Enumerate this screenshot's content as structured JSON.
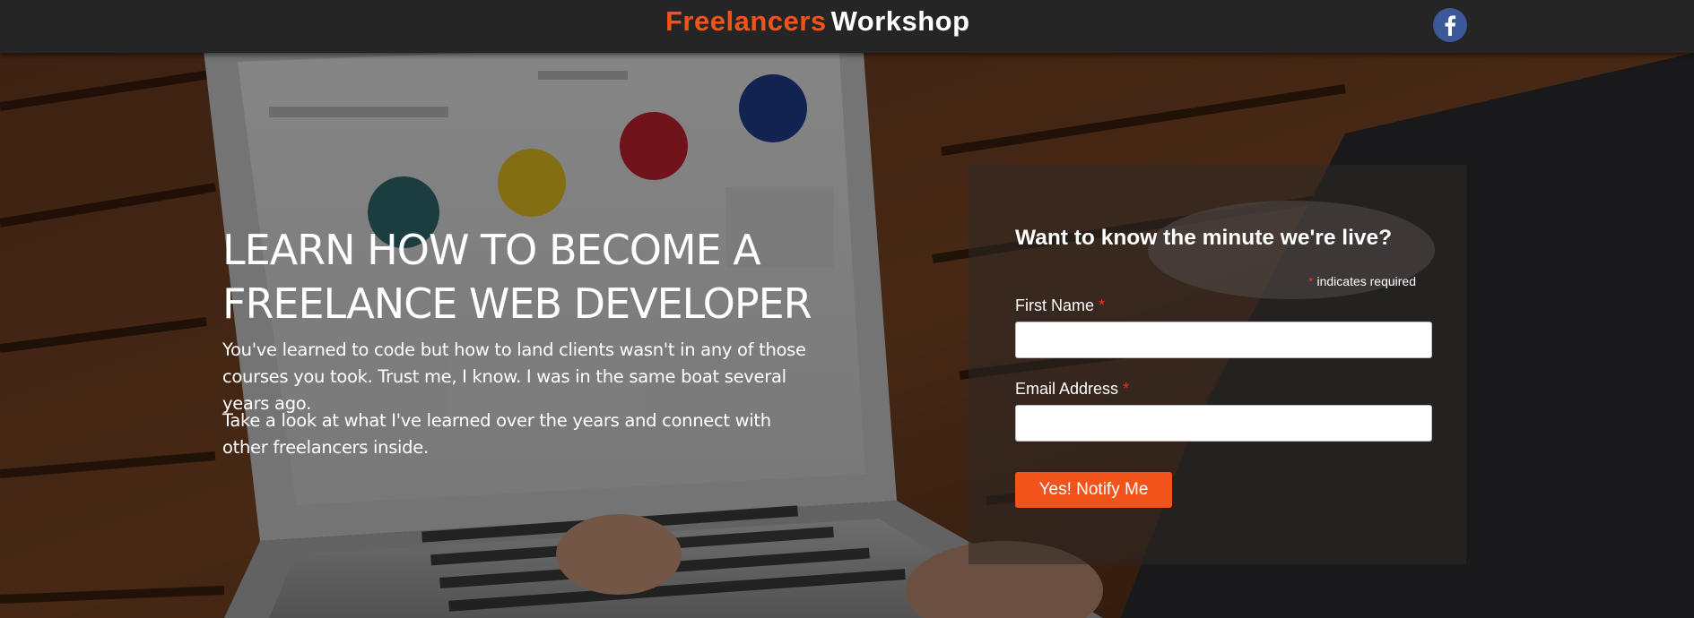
{
  "header": {
    "logo_word_1": "Freelancers",
    "logo_word_2": "Workshop",
    "social_icon": "facebook-icon"
  },
  "hero": {
    "headline": "LEARN HOW TO BECOME A FREELANCE WEB DEVELOPER",
    "paragraph_1": "You've learned to code but how to land clients wasn't in any of those courses you took. Trust me, I know. I was in the same boat several years ago.",
    "paragraph_2": "Take a look at what I've learned over the years and connect with other freelancers inside."
  },
  "form": {
    "title": "Want to know the minute we're live?",
    "required_mark": "*",
    "required_note": "indicates required",
    "first_name_label": "First Name",
    "first_name_value": "",
    "email_label": "Email Address",
    "email_value": "",
    "submit_label": "Yes! Notify Me"
  },
  "colors": {
    "brand_orange": "#f2531b",
    "header_bg": "#252525",
    "facebook_blue": "#3b5998",
    "required_red": "#e8331b"
  }
}
